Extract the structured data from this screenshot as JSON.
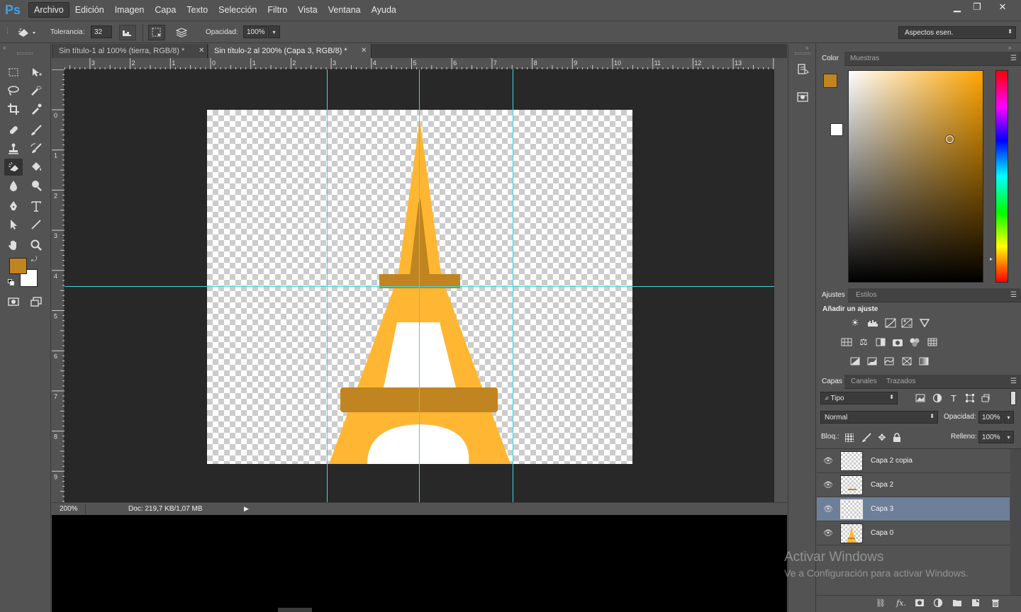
{
  "app": {
    "logo": "Ps"
  },
  "menu": [
    "Archivo",
    "Edición",
    "Imagen",
    "Capa",
    "Texto",
    "Selección",
    "Filtro",
    "Vista",
    "Ventana",
    "Ayuda"
  ],
  "window_controls": {
    "minimize": "▁",
    "restore": "❐",
    "close": "✕"
  },
  "options": {
    "tolerance_label": "Tolerancia:",
    "tolerance_value": "32",
    "opacity_label": "Opacidad:",
    "opacity_value": "100%",
    "workspace": "Aspectos esen."
  },
  "tabs": [
    {
      "label": "Sin título-1 al 100% (tierra, RGB/8) *",
      "active": false
    },
    {
      "label": "Sin título-2 al 200% (Capa 3, RGB/8) *",
      "active": true
    }
  ],
  "ruler_top": [
    "3",
    "2",
    "1",
    "0",
    "1",
    "2",
    "3",
    "4",
    "5",
    "6",
    "7",
    "8",
    "9",
    "10",
    "11",
    "12",
    "13"
  ],
  "ruler_left": [
    "0",
    "1",
    "2",
    "3",
    "4",
    "5",
    "6",
    "7",
    "8",
    "9"
  ],
  "status": {
    "zoom": "200%",
    "doc": "Doc: 219,7 KB/1,07 MB"
  },
  "colors": {
    "foreground": "#c08520",
    "background": "#ffffff",
    "tower_main": "#ffb633",
    "tower_dark": "#c08520",
    "guide": "#3fd6dc"
  },
  "color_panel": {
    "tabs": [
      "Color",
      "Muestras"
    ]
  },
  "adjust_panel": {
    "tabs": [
      "Ajustes",
      "Estilos"
    ],
    "heading": "Añadir un ajuste"
  },
  "layers_panel": {
    "tabs": [
      "Capas",
      "Canales",
      "Trazados"
    ],
    "filter": "Tipo",
    "blend_mode": "Normal",
    "opacity_label": "Opacidad:",
    "opacity_value": "100%",
    "lock_label": "Bloq.:",
    "fill_label": "Relleno:",
    "fill_value": "100%",
    "layers": [
      {
        "name": "Capa 2 copia",
        "selected": false
      },
      {
        "name": "Capa 2",
        "selected": false
      },
      {
        "name": "Capa 3",
        "selected": true
      },
      {
        "name": "Capa 0",
        "selected": false
      }
    ]
  },
  "watermark": {
    "title": "Activar Windows",
    "subtitle": "Ve a Configuración para activar Windows."
  }
}
